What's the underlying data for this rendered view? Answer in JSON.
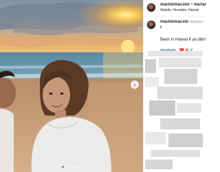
{
  "post": {
    "header": {
      "username": "mackiemacster",
      "separator": " • ",
      "second_user": "mariama",
      "location": "Waikiki, Honolulu, Hawaii"
    },
    "caption": {
      "username_line1": "mackiemacste",
      "username_line2": "r",
      "edited": "Edytowa",
      "text": "Been in Hawaii if ya didn't",
      "hashtag": "#mahalo",
      "emojis": "❤️🌋🌊"
    },
    "carousel": {
      "next_icon": "chevron-right-icon",
      "dot_count": 6,
      "active_dot": 0
    }
  },
  "colors": {
    "sunset_glow": "#ffc04a",
    "ocean": "#5f8fa8",
    "sand": "#c49a72",
    "active_dot": "#3897f0",
    "hashtag": "#00376b"
  }
}
